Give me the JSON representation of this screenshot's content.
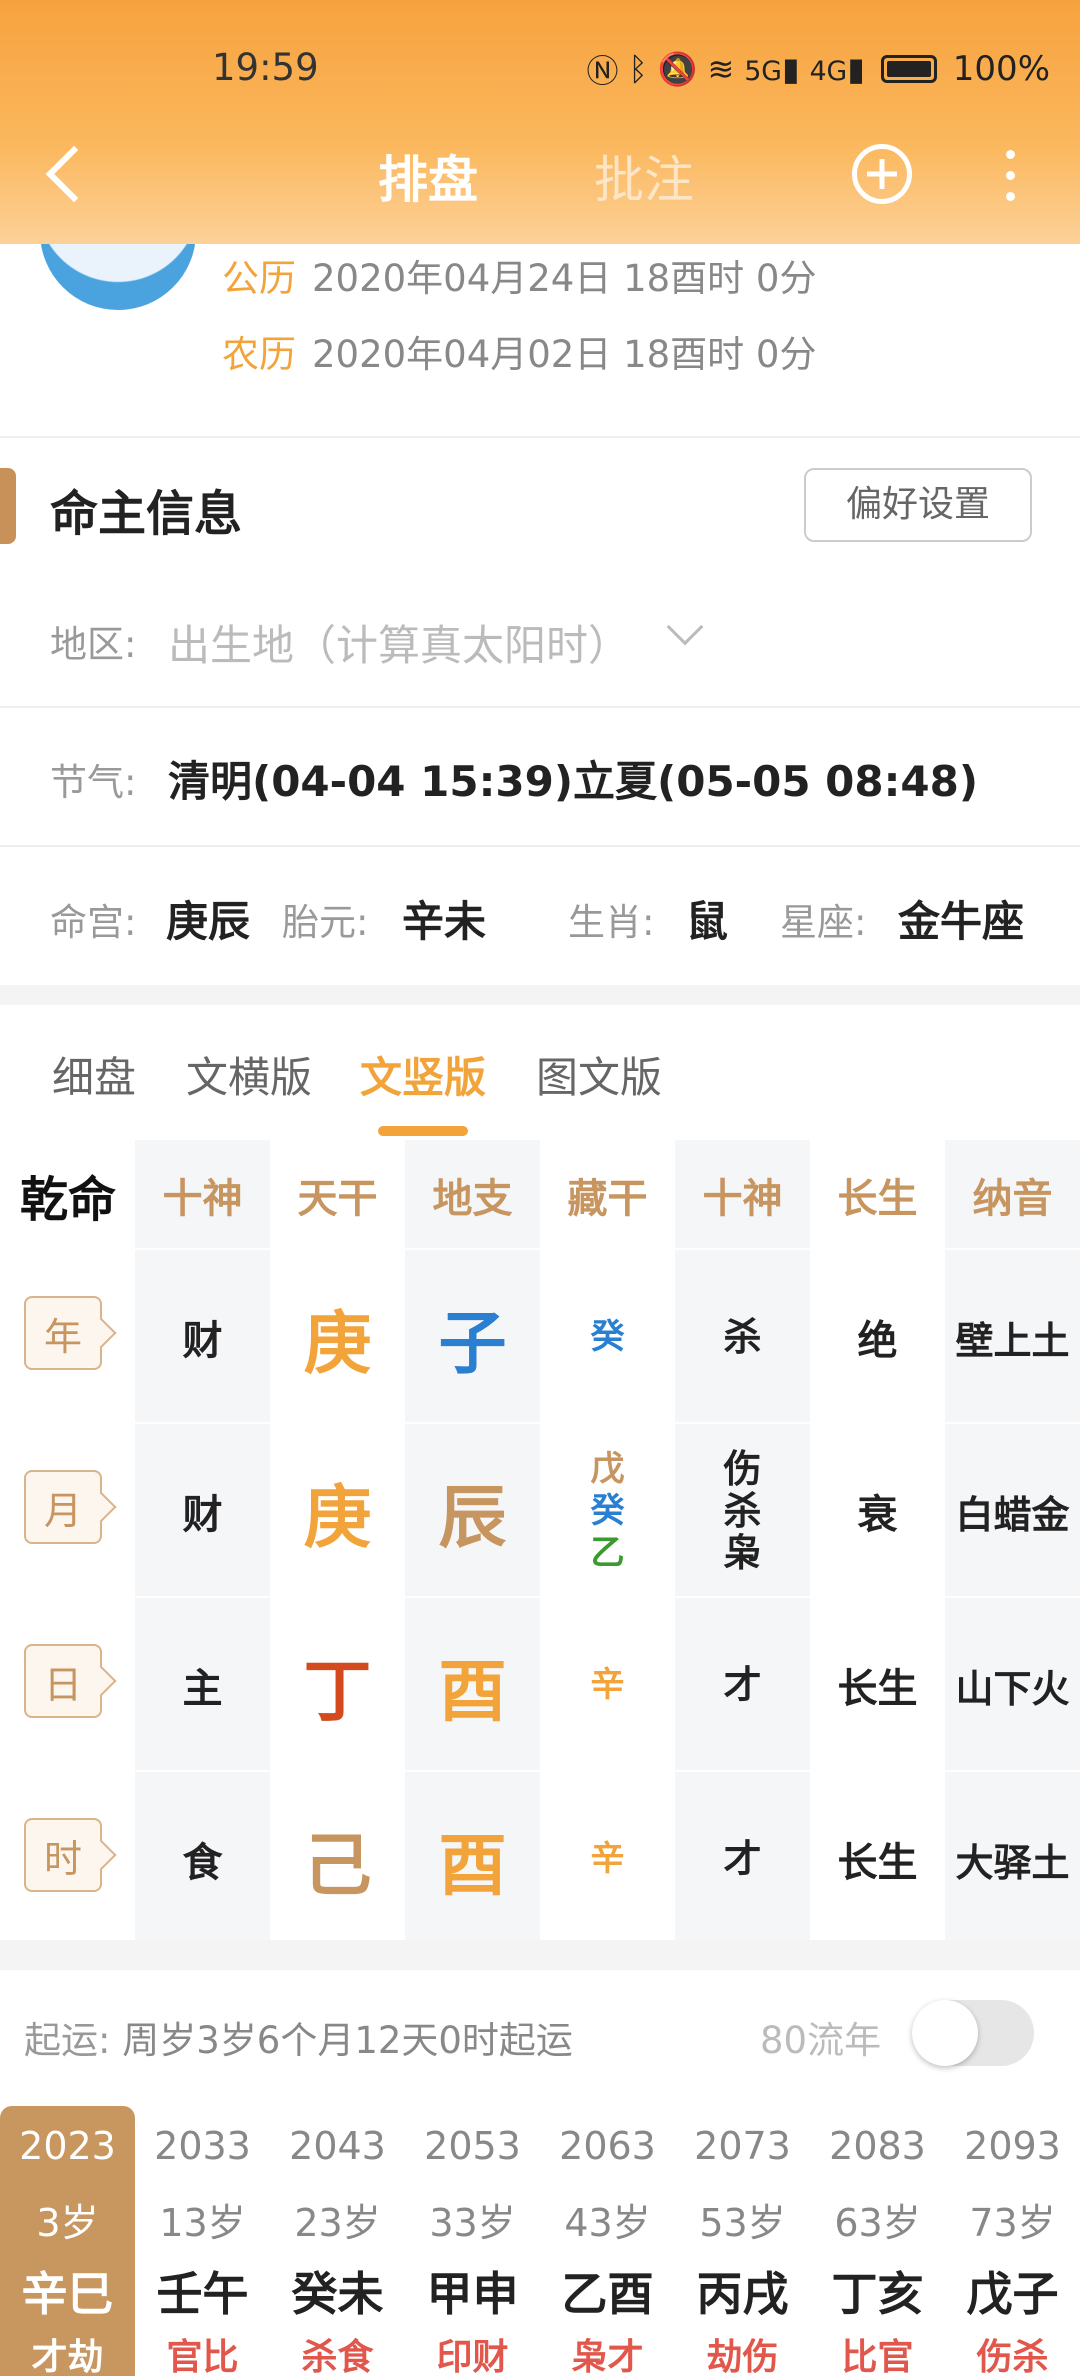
{
  "status": {
    "time": "19:59",
    "battery": "100%",
    "net1": "5G",
    "net2": "4G"
  },
  "nav": {
    "tab_main": "排盘",
    "tab_note": "批注"
  },
  "profile": {
    "solar_label": "公历",
    "solar_value": "2020年04月24日 18酉时 0分",
    "lunar_label": "农历",
    "lunar_value": "2020年04月02日 18酉时 0分"
  },
  "info": {
    "title": "命主信息",
    "pref_button": "偏好设置",
    "region_label": "地区:",
    "region_placeholder": "出生地（计算真太阳时）",
    "jieqi_label": "节气:",
    "jieqi_value": "清明(04-04 15:39)立夏(05-05 08:48)",
    "minggong_label": "命宫:",
    "minggong_value": "庚辰",
    "taiyuan_label": "胎元:",
    "taiyuan_value": "辛未",
    "shengxiao_label": "生肖:",
    "shengxiao_value": "鼠",
    "xingzuo_label": "星座:",
    "xingzuo_value": "金牛座"
  },
  "view_tabs": [
    "细盘",
    "文横版",
    "文竖版",
    "图文版"
  ],
  "table": {
    "corner": "乾命",
    "headers": [
      "十神",
      "天干",
      "地支",
      "藏干",
      "十神",
      "长生",
      "纳音"
    ],
    "rows": [
      {
        "pillar": "年",
        "shishen": "财",
        "gan": "庚",
        "zhi": "子",
        "cang": [
          "癸"
        ],
        "shen": [
          "杀"
        ],
        "changsheng": "绝",
        "nayin": "壁上土"
      },
      {
        "pillar": "月",
        "shishen": "财",
        "gan": "庚",
        "zhi": "辰",
        "cang": [
          "戊",
          "癸",
          "乙"
        ],
        "shen": [
          "伤",
          "杀",
          "枭"
        ],
        "changsheng": "衰",
        "nayin": "白蜡金"
      },
      {
        "pillar": "日",
        "shishen": "主",
        "gan": "丁",
        "zhi": "酉",
        "cang": [
          "辛"
        ],
        "shen": [
          "才"
        ],
        "changsheng": "长生",
        "nayin": "山下火"
      },
      {
        "pillar": "时",
        "shishen": "食",
        "gan": "己",
        "zhi": "酉",
        "cang": [
          "辛"
        ],
        "shen": [
          "才"
        ],
        "changsheng": "长生",
        "nayin": "大驿土"
      }
    ]
  },
  "colors": {
    "gold": "#f2a33a",
    "blue": "#2a7fd0",
    "red": "#d4491e",
    "brown": "#c7955f",
    "green": "#3a9a2e",
    "accent": "#f7a23e"
  },
  "luck": {
    "qiyun_label": "起运:",
    "qiyun_value": "周岁3岁6个月12天0时起运",
    "liunian": "80流年",
    "cols": [
      {
        "year": "2023",
        "age": "3岁",
        "gz": "辛巳",
        "ss": "才劫"
      },
      {
        "year": "2033",
        "age": "13岁",
        "gz": "壬午",
        "ss": "官比"
      },
      {
        "year": "2043",
        "age": "23岁",
        "gz": "癸未",
        "ss": "杀食"
      },
      {
        "year": "2053",
        "age": "33岁",
        "gz": "甲申",
        "ss": "印财"
      },
      {
        "year": "2063",
        "age": "43岁",
        "gz": "乙酉",
        "ss": "枭才"
      },
      {
        "year": "2073",
        "age": "53岁",
        "gz": "丙戌",
        "ss": "劫伤"
      },
      {
        "year": "2083",
        "age": "63岁",
        "gz": "丁亥",
        "ss": "比官"
      },
      {
        "year": "2093",
        "age": "73岁",
        "gz": "戊子",
        "ss": "伤杀"
      }
    ]
  }
}
